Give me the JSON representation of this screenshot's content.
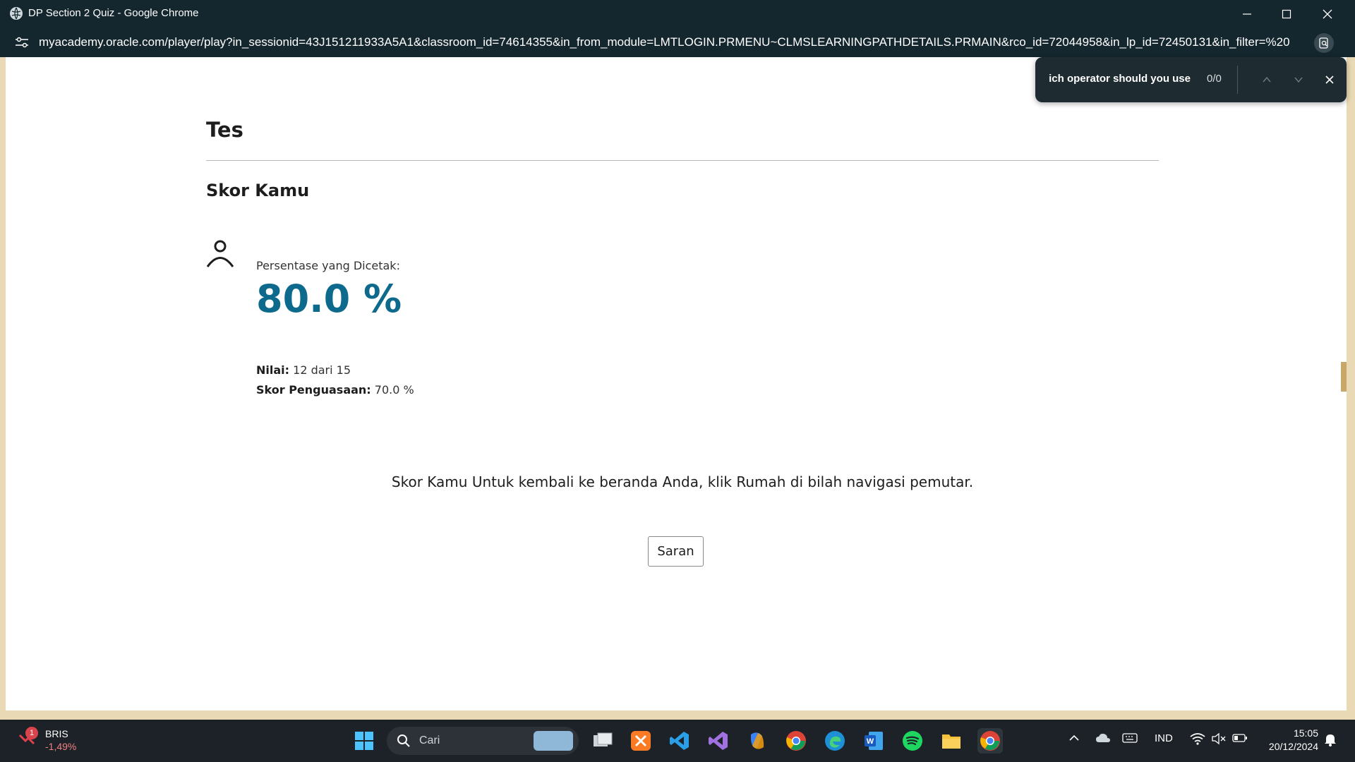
{
  "browser": {
    "window_title": "DP Section 2 Quiz - Google Chrome",
    "url": "myacademy.oracle.com/player/play?in_sessionid=43J151211933A5A1&classroom_id=74614355&in_from_module=LMTLOGIN.PRMENU~CLMSLEARNINGPATHDETAILS.PRMAIN&rco_id=72044958&in_lp_id=72450131&in_filter=%20"
  },
  "find_bar": {
    "query": "Which operator should you use?",
    "count": "0/0"
  },
  "quiz": {
    "heading": "Tes",
    "score_heading": "Skor Kamu",
    "percentage_label": "Persentase yang Dicetak:",
    "percentage_value": "80.0 %",
    "grade_label": "Nilai:",
    "grade_value": "12 dari 15",
    "mastery_label": "Skor Penguasaan:",
    "mastery_value": "70.0 %",
    "message": "Skor Kamu Untuk kembali ke beranda Anda, klik Rumah di bilah navigasi pemutar.",
    "feedback_button": "Saran"
  },
  "taskbar": {
    "stock_name": "BRIS",
    "stock_change": "-1,49%",
    "notification_count": "1",
    "search_placeholder": "Cari",
    "language": "IND",
    "time": "15:05",
    "date": "20/12/2024",
    "apps": [
      "windows-start",
      "task-view",
      "xampp",
      "vscode",
      "visual-studio",
      "copilot",
      "chrome",
      "edge",
      "word",
      "spotify",
      "file-explorer",
      "chrome-active"
    ]
  },
  "colors": {
    "accent_score": "#0e6a8c",
    "titlebar": "#14262e",
    "taskbar": "#1c2228"
  }
}
